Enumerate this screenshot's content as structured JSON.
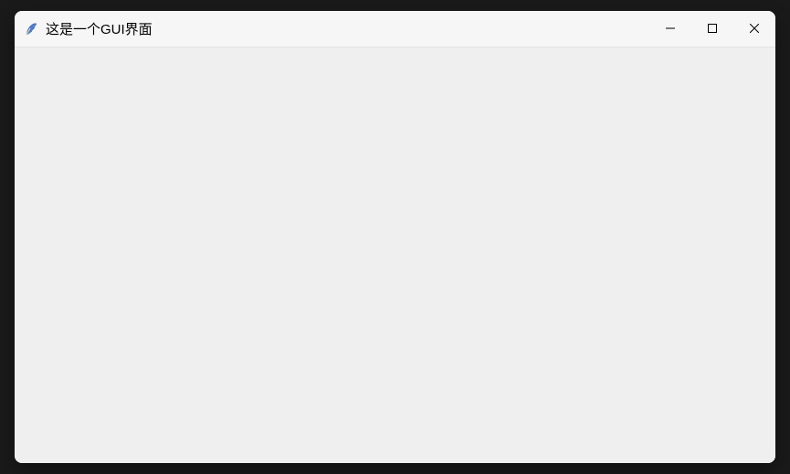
{
  "window": {
    "title": "这是一个GUI界面",
    "icon": "feather-icon"
  }
}
